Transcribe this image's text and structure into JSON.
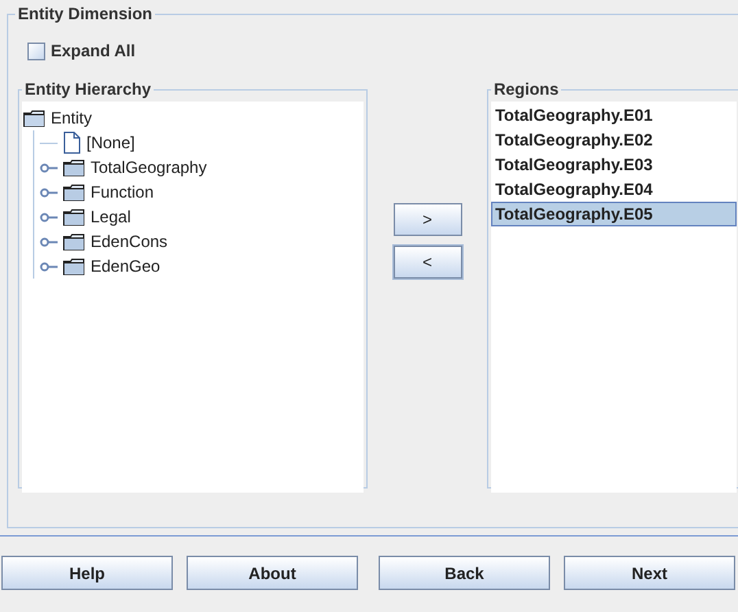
{
  "dimension_group": {
    "title": "Entity Dimension"
  },
  "expand_all": {
    "label": "Expand All",
    "checked": false
  },
  "hierarchy": {
    "title": "Entity Hierarchy",
    "tree": [
      {
        "label": "Entity",
        "kind": "folder",
        "expanded": true,
        "children": [
          {
            "label": "[None]",
            "kind": "leaf"
          },
          {
            "label": "TotalGeography",
            "kind": "folder",
            "expanded": false
          },
          {
            "label": "Function",
            "kind": "folder",
            "expanded": false
          },
          {
            "label": "Legal",
            "kind": "folder",
            "expanded": false
          },
          {
            "label": "EdenCons",
            "kind": "folder",
            "expanded": false
          },
          {
            "label": "EdenGeo",
            "kind": "folder",
            "expanded": false
          }
        ]
      }
    ]
  },
  "move_buttons": [
    {
      "label": ">",
      "focused": false
    },
    {
      "label": "<",
      "focused": true
    }
  ],
  "regions": {
    "title": "Regions",
    "items": [
      {
        "label": "TotalGeography.E01",
        "selected": false
      },
      {
        "label": "TotalGeography.E02",
        "selected": false
      },
      {
        "label": "TotalGeography.E03",
        "selected": false
      },
      {
        "label": "TotalGeography.E04",
        "selected": false
      },
      {
        "label": "TotalGeography.E05",
        "selected": true
      }
    ]
  },
  "footer_buttons": [
    "Help",
    "About",
    "Back",
    "Next"
  ]
}
